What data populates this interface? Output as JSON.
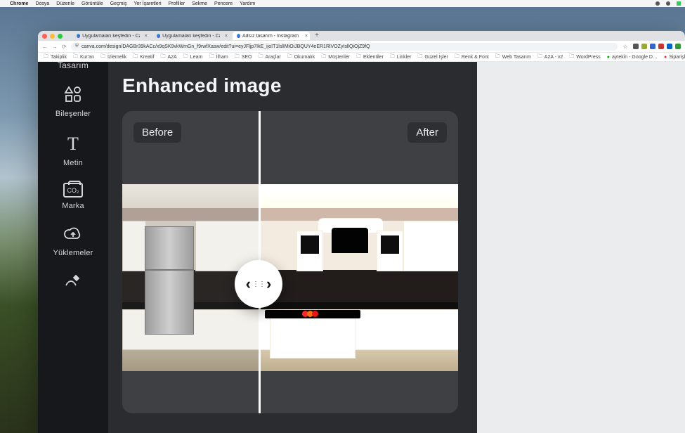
{
  "menubar": {
    "app": "Chrome",
    "items": [
      "Dosya",
      "Düzenle",
      "Görüntüle",
      "Geçmiş",
      "Yer İşaretleri",
      "Profiller",
      "Sekme",
      "Pencere",
      "Yardım"
    ]
  },
  "tabs": [
    {
      "label": "Uygulamaları keşfedin - Can…",
      "fav": "c",
      "active": false
    },
    {
      "label": "Uygulamaları keşfedin - Can…",
      "fav": "c",
      "active": false
    },
    {
      "label": "Adsız tasarım - Instagram Gö…",
      "fav": "c",
      "active": true
    }
  ],
  "address": {
    "url": "canva.com/design/DAGBr39kACc/x9qSK9vkWmGn_f9rwfXasw/edit?ui=eyJFljp7IkE_ijoIT1lslIMiOiJBQUY4eER1RlVOZyIsllQiOjZ9fQ"
  },
  "bookmarks": [
    "Takiplik",
    "Kur'an",
    "İzlemelik",
    "Kreatif",
    "A2A",
    "Learn",
    "İlham",
    "SEO",
    "Araçlar",
    "Okumalık",
    "Müşteriler",
    "Eklentiler",
    "Linkler",
    "Güzel İşler",
    "Renk & Font",
    "Web Tasarım",
    "A2A - v2",
    "WordPress",
    "aytekin - Google D…",
    "Siparişlerim"
  ],
  "sidebar": {
    "items": [
      {
        "label": "Tasarım",
        "icon": ""
      },
      {
        "label": "Bileşenler",
        "icon": "shapes"
      },
      {
        "label": "Metin",
        "icon": "t"
      },
      {
        "label": "Marka",
        "icon": "box"
      },
      {
        "label": "Yüklemeler",
        "icon": "cloud"
      },
      {
        "label": "",
        "icon": "pen"
      }
    ]
  },
  "editor": {
    "title": "Enhanced image",
    "before_label": "Before",
    "after_label": "After"
  }
}
